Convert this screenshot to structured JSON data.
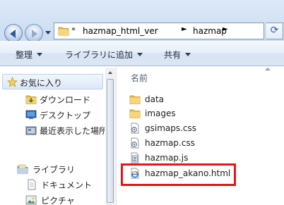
{
  "address_bar": {
    "overflow": "«",
    "segments": [
      "hazmap_html_ver",
      "hazmap"
    ]
  },
  "command_bar": {
    "organize": "整理",
    "include_in_library": "ライブラリに追加",
    "share_with": "共有"
  },
  "nav_pane": {
    "favorites": "お気に入り",
    "downloads": "ダウンロード",
    "desktop": "デスクトップ",
    "recent": "最近表示した場所",
    "libraries": "ライブラリ",
    "documents": "ドキュメント",
    "pictures": "ピクチャ"
  },
  "file_list": {
    "column_name": "名前",
    "items": [
      {
        "name": "data",
        "icon": "folder-icon"
      },
      {
        "name": "images",
        "icon": "folder-icon"
      },
      {
        "name": "gsimaps.css",
        "icon": "css-file-icon"
      },
      {
        "name": "hazmap.css",
        "icon": "css-file-icon"
      },
      {
        "name": "hazmap.js",
        "icon": "js-file-icon"
      },
      {
        "name": "hazmap_akano.html",
        "icon": "html-file-icon"
      }
    ]
  },
  "colors": {
    "highlight": "#e8141a",
    "folder": "#f0c75a",
    "accent": "#2e5b96"
  }
}
